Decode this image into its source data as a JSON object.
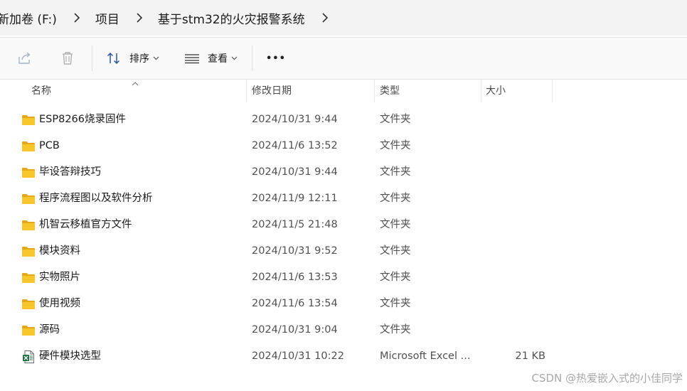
{
  "breadcrumb": {
    "items": [
      {
        "label": "新加卷 (F:)"
      },
      {
        "label": "项目"
      },
      {
        "label": "基于stm32的火灾报警系统"
      }
    ]
  },
  "toolbar": {
    "share_icon": "share-icon",
    "delete_icon": "trash-icon",
    "sort_label": "排序",
    "view_label": "查看",
    "more_label": "•••"
  },
  "columns": {
    "name": "名称",
    "modified": "修改日期",
    "type": "类型",
    "size": "大小"
  },
  "files": [
    {
      "name": "ESP8266烧录固件",
      "modified": "2024/10/31 9:44",
      "type": "文件夹",
      "size": "",
      "icon": "folder-icon"
    },
    {
      "name": "PCB",
      "modified": "2024/11/6 13:52",
      "type": "文件夹",
      "size": "",
      "icon": "folder-icon"
    },
    {
      "name": "毕设答辩技巧",
      "modified": "2024/10/31 9:44",
      "type": "文件夹",
      "size": "",
      "icon": "folder-icon"
    },
    {
      "name": "程序流程图以及软件分析",
      "modified": "2024/11/9 12:11",
      "type": "文件夹",
      "size": "",
      "icon": "folder-icon"
    },
    {
      "name": "机智云移植官方文件",
      "modified": "2024/11/5 21:48",
      "type": "文件夹",
      "size": "",
      "icon": "folder-icon"
    },
    {
      "name": "模块资料",
      "modified": "2024/10/31 9:52",
      "type": "文件夹",
      "size": "",
      "icon": "folder-icon"
    },
    {
      "name": "实物照片",
      "modified": "2024/11/6 13:53",
      "type": "文件夹",
      "size": "",
      "icon": "folder-icon"
    },
    {
      "name": "使用视频",
      "modified": "2024/11/6 13:54",
      "type": "文件夹",
      "size": "",
      "icon": "folder-icon"
    },
    {
      "name": "源码",
      "modified": "2024/10/31 9:04",
      "type": "文件夹",
      "size": "",
      "icon": "folder-icon"
    },
    {
      "name": "硬件模块选型",
      "modified": "2024/10/31 10:22",
      "type": "Microsoft Excel ...",
      "size": "21 KB",
      "icon": "excel-file-icon"
    }
  ],
  "watermark": "CSDN @热爱嵌入式的小佳同学",
  "colors": {
    "folder": "#f8c52a",
    "folder_dark": "#e6a817",
    "excel_green": "#1e7145",
    "accent": "#0067c0"
  }
}
